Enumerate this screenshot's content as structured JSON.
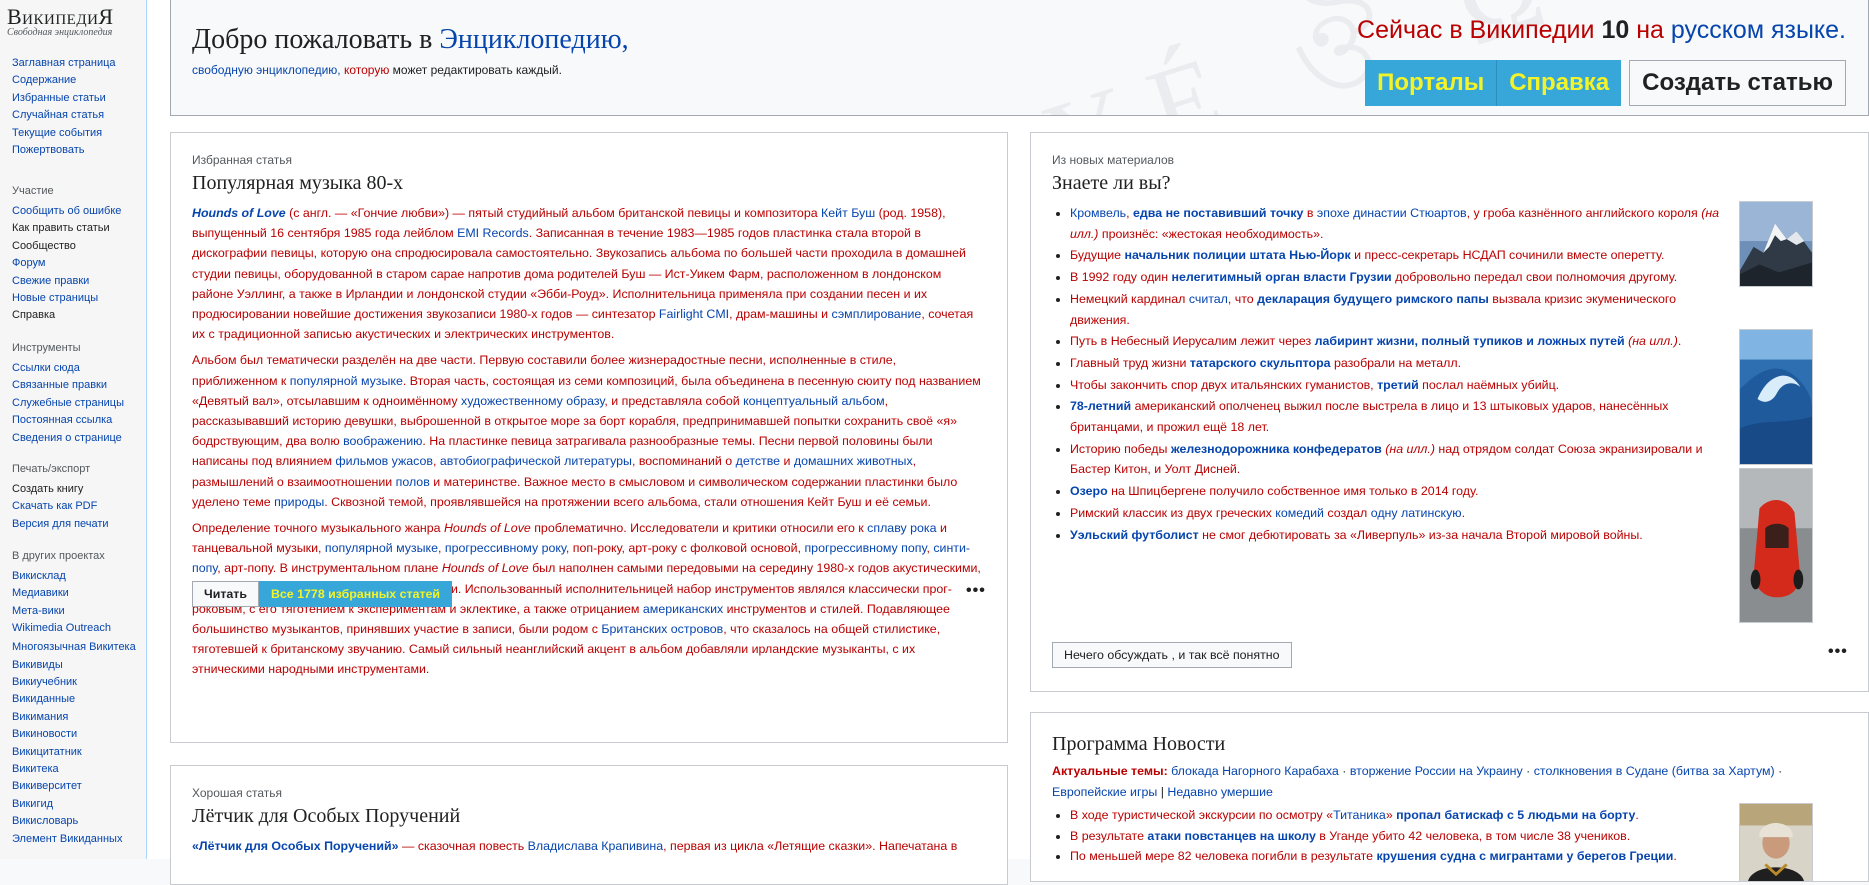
{
  "logo": {
    "title": "ВикипедиЯ",
    "subtitle": "Свободная энциклопедия"
  },
  "sidebar": {
    "main": [
      "Заглавная страница",
      "Содержание",
      "Избранные статьи",
      "Случайная статья",
      "Текущие события",
      "Пожертвовать"
    ],
    "participation": {
      "heading": "Участие",
      "items": [
        "Сообщить об ошибке",
        "Как править статьи",
        "Сообщество",
        "Форум",
        "Свежие правки",
        "Новые страницы",
        "Справка"
      ]
    },
    "tools": {
      "heading": "Инструменты",
      "items": [
        "Ссылки сюда",
        "Связанные правки",
        "Служебные страницы",
        "Постоянная ссылка",
        "Сведения о странице"
      ]
    },
    "print": {
      "heading": "Печать/экспорт",
      "items": [
        "Создать книгу",
        "Скачать как PDF",
        "Версия для печати"
      ]
    },
    "projects": {
      "heading": "В других проектах",
      "items": [
        "Викисклад",
        "Медиавики",
        "Мета-вики",
        "Wikimedia Outreach",
        "Многоязычная Викитека",
        "Викивиды",
        "Викиучебник",
        "Викиданные",
        "Викимания",
        "Викиновости",
        "Викицитатник",
        "Викитека",
        "Викиверситет",
        "Викигид",
        "Викисловарь",
        "Элемент Викиданных"
      ]
    }
  },
  "welcome": {
    "title_prefix": "Добро пожаловать в ",
    "title_link": "Энциклопедию,",
    "sub_1": "свободную энциклопедию, ",
    "sub_2": "которую",
    "sub_3": " может редактировать каждый.",
    "count_1": "Сейчас в Википедии ",
    "count_num": "10",
    "count_2": " на ",
    "count_link": "русском языке.",
    "btn_portals": "Порталы",
    "btn_help": "Справка",
    "btn_create": "Создать статью",
    "background_glyphs": "ΑΥÉ ঔ Ω"
  },
  "featured": {
    "kicker": "Избранная статья",
    "title": "Популярная музыка 80-х",
    "p1": [
      {
        "t": "Hounds of Love",
        "c": "blue b i"
      },
      {
        "t": " (с англ. — «Гончие любви») — пятый студийный альбом британской ",
        "c": ""
      },
      {
        "t": "певицы и композитора",
        "c": ""
      },
      {
        "t": " Кейт Буш",
        "c": "blue"
      },
      {
        "t": " (род. 1958), выпущенный 16 сентября 1985 года лейблом ",
        "c": ""
      },
      {
        "t": "EMI Records",
        "c": "blue"
      },
      {
        "t": ". Записанная в течение 1983—1985 годов пластинка стала второй в дискографии певицы, которую она спродюсировала самостоятельно. Звукозапись альбома по большей части проходила в домашней студии певицы, оборудованной в старом сарае напротив дома родителей Буш — Ист-Уикем Фарм, расположенном в лондонском районе Уэллинг, а также в Ирландии и лондонской студии «Эбби-Роуд». Исполнительница применяла при создании песен и их продюсировании новейшие достижения звукозаписи 1980-х годов — синтезатор ",
        "c": ""
      },
      {
        "t": "Fairlight CMI",
        "c": "blue"
      },
      {
        "t": ", драм-машины и ",
        "c": ""
      },
      {
        "t": "сэмплирование",
        "c": "blue"
      },
      {
        "t": ", сочетая их с традиционной записью акустических и электрических инструментов.",
        "c": ""
      }
    ],
    "p2": [
      {
        "t": "Альбом был тематически разделён на две части. Первую составили более жизнерадостные песни, исполненные в стиле, приближенном к ",
        "c": ""
      },
      {
        "t": "популярной музыке",
        "c": "blue"
      },
      {
        "t": ". Вторая часть, состоящая из семи композиций, была объединена в песенную сюиту под названием «Девятый вал», отсылавшим к одноимённому ",
        "c": ""
      },
      {
        "t": "художественному образу",
        "c": "blue"
      },
      {
        "t": ", и представляла собой ",
        "c": ""
      },
      {
        "t": "концептуальный альбом",
        "c": "blue"
      },
      {
        "t": ", рассказывавший историю девушки, выброшенной в открытое море за борт корабля, предпринимавшей попытки сохранить своё «я» бодрствующим, два волю ",
        "c": ""
      },
      {
        "t": "воображению",
        "c": "blue"
      },
      {
        "t": ". На пластинке певица затрагивала разнообразные темы. Песни первой половины были написаны под влиянием ",
        "c": ""
      },
      {
        "t": "фильмов ужасов",
        "c": "blue"
      },
      {
        "t": ", ",
        "c": ""
      },
      {
        "t": "автобиографической литературы",
        "c": "blue"
      },
      {
        "t": ", воспоминаний о ",
        "c": ""
      },
      {
        "t": "детстве",
        "c": "blue"
      },
      {
        "t": " и ",
        "c": ""
      },
      {
        "t": "домашних животных",
        "c": "blue"
      },
      {
        "t": ", размышлений о взаимоотношении ",
        "c": ""
      },
      {
        "t": "полов",
        "c": "blue"
      },
      {
        "t": " и материнстве. Важное место в смысловом и символическом содержании пластинки было уделено теме ",
        "c": ""
      },
      {
        "t": "природы",
        "c": "blue"
      },
      {
        "t": ". Сквозной темой, проявлявшейся на протяжении всего альбома, стали отношения Кейт Буш и её семьи.",
        "c": ""
      }
    ],
    "p3": [
      {
        "t": "Определение точного музыкального жанра ",
        "c": ""
      },
      {
        "t": "Hounds of Love",
        "c": "i"
      },
      {
        "t": " проблематично. Исследователи и критики относили его к ",
        "c": ""
      },
      {
        "t": "сплаву рока",
        "c": "blue"
      },
      {
        "t": " и танцевальной музыки, ",
        "c": ""
      },
      {
        "t": "популярной музыке",
        "c": "blue"
      },
      {
        "t": ", ",
        "c": ""
      },
      {
        "t": "прогрессивному року",
        "c": "blue"
      },
      {
        "t": ", поп-року, арт-року с фолковой основой, ",
        "c": ""
      },
      {
        "t": "прогрессивному попу",
        "c": "blue"
      },
      {
        "t": ", ",
        "c": ""
      },
      {
        "t": "синти-попу",
        "c": "blue"
      },
      {
        "t": ", арт-попу. В инструментальном плане ",
        "c": ""
      },
      {
        "t": "Hounds of Love",
        "c": "i"
      },
      {
        "t": " был наполнен самыми передовыми на середину 1980-х годов акустическими, электрическими и синтезированными звуками. Использованный исполнительницей набор инструментов являлся классически прог-роковым, с его тяготением к экспериментам и эклектике, а также отрицанием ",
        "c": ""
      },
      {
        "t": "американских",
        "c": "blue"
      },
      {
        "t": " инструментов и стилей. Подавляющее большинство музыкантов, принявших участие в записи, были родом с ",
        "c": ""
      },
      {
        "t": "Британских островов",
        "c": "blue"
      },
      {
        "t": ", что сказалось на общей стилистике, тяготевшей к британскому звучанию. Самый сильный неанглийский акцент в альбом добавляли ирландские музыканты, с их этническими народными инструментами.",
        "c": ""
      }
    ],
    "btn_read": "Читать",
    "btn_all": "Все 1778 избранных статей",
    "more": "•••"
  },
  "dyk": {
    "kicker": "Из новых материалов",
    "title": "Знаете ли вы?",
    "items": [
      [
        {
          "t": "Кромвель",
          "c": "blue"
        },
        {
          "t": ", ",
          "c": ""
        },
        {
          "t": "едва не поставивший точку",
          "c": "blue b"
        },
        {
          "t": " в ",
          "c": ""
        },
        {
          "t": "эпохе династии Стюартов",
          "c": "blue"
        },
        {
          "t": ", у гроба казнённого английского короля ",
          "c": ""
        },
        {
          "t": "(на илл.)",
          "c": "i"
        },
        {
          "t": " произнёс: «жестокая необходимость».",
          "c": ""
        }
      ],
      [
        {
          "t": "Будущие ",
          "c": ""
        },
        {
          "t": "начальник полиции штата Нью-Йорк",
          "c": "blue b"
        },
        {
          "t": " и пресс-секретарь НСДАП сочинили вместе оперетту.",
          "c": ""
        }
      ],
      [
        {
          "t": "В 1992 году",
          "c": ""
        },
        {
          "t": " один ",
          "c": ""
        },
        {
          "t": "нелегитимный орган власти Грузии",
          "c": "blue b"
        },
        {
          "t": " добровольно передал свои полномочия другому.",
          "c": ""
        }
      ],
      [
        {
          "t": "Немецкий кардинал ",
          "c": ""
        },
        {
          "t": "считал",
          "c": "blue"
        },
        {
          "t": ", что ",
          "c": ""
        },
        {
          "t": "декларация будущего римского папы",
          "c": "blue b"
        },
        {
          "t": " вызвала кризис экуменического движения.",
          "c": ""
        }
      ],
      [
        {
          "t": "Путь в Небесный Иерусалим",
          "c": ""
        },
        {
          "t": " лежит через ",
          "c": ""
        },
        {
          "t": "лабиринт жизни, полный тупиков и ложных путей",
          "c": "blue b"
        },
        {
          "t": " ",
          "c": ""
        },
        {
          "t": "(на илл.)",
          "c": "i"
        },
        {
          "t": ".",
          "c": ""
        }
      ],
      [
        {
          "t": "Главный труд жизни ",
          "c": ""
        },
        {
          "t": "татарского скульптора",
          "c": "blue b"
        },
        {
          "t": " разобрали на металл.",
          "c": ""
        }
      ],
      [
        {
          "t": "Чтобы закончить спор двух итальянских гуманистов, ",
          "c": ""
        },
        {
          "t": "третий",
          "c": "blue b"
        },
        {
          "t": " послал наёмных убийц.",
          "c": ""
        }
      ],
      [
        {
          "t": "78-летний",
          "c": "blue b"
        },
        {
          "t": " американский ополченец выжил после выстрела в лицо и 13 штыковых ударов, нанесённых британцами, и прожил ещё 18 лет.",
          "c": ""
        }
      ],
      [
        {
          "t": "Историю победы ",
          "c": ""
        },
        {
          "t": "железнодорожника конфедератов",
          "c": "blue b"
        },
        {
          "t": " ",
          "c": ""
        },
        {
          "t": "(на илл.)",
          "c": "i"
        },
        {
          "t": " над отрядом солдат Союза ",
          "c": ""
        },
        {
          "t": "экранизировали",
          "c": ""
        },
        {
          "t": " и Бастер Китон, и Уолт Дисней.",
          "c": ""
        }
      ],
      [
        {
          "t": "Озеро",
          "c": "blue b"
        },
        {
          "t": " на Шпицбергене получило собственное имя только в 2014 году.",
          "c": ""
        }
      ],
      [
        {
          "t": "Римский классик из двух греческих ",
          "c": ""
        },
        {
          "t": "комедий",
          "c": "blue"
        },
        {
          "t": " создал ",
          "c": ""
        },
        {
          "t": "одну латинскую",
          "c": "blue"
        },
        {
          "t": ".",
          "c": ""
        }
      ],
      [
        {
          "t": "Уэльский футболист",
          "c": "blue b"
        },
        {
          "t": " не смог дебютировать за «Ливерпуль» из-за начала Второй мировой войны.",
          "c": ""
        }
      ]
    ],
    "btn_discuss": "Нечего обсуждать , и так всё понятно",
    "more": "•••",
    "thumbs": [
      "mountain-photo",
      "wave-photo",
      "red-car-photo"
    ]
  },
  "good": {
    "kicker": "Хорошая статья",
    "title": "Лётчик для Особых Поручений",
    "p1": [
      {
        "t": "«Лётчик для Особых Поручений»",
        "c": "blue b"
      },
      {
        "t": " — сказочная повесть ",
        "c": ""
      },
      {
        "t": "Владислава Крапивина",
        "c": "blue"
      },
      {
        "t": ", первая из цикла «Летящие сказки». Напечатана в",
        "c": ""
      }
    ]
  },
  "news": {
    "title": "Программа Новости",
    "topics_label": "Актуальные темы:",
    "topics": [
      {
        "t": " блокада Нагорного Карабаха",
        "c": "blue"
      },
      {
        "t": " · ",
        "c": "dark"
      },
      {
        "t": "вторжение России на Украину",
        "c": "blue"
      },
      {
        "t": " · ",
        "c": "dark"
      },
      {
        "t": "столкновения в Судане (битва за Хартум)",
        "c": "blue"
      },
      {
        "t": " · ",
        "c": "dark"
      },
      {
        "t": "Европейские игры",
        "c": "blue"
      },
      {
        "t": " | ",
        "c": "dark"
      },
      {
        "t": "Недавно умершие",
        "c": "blue"
      }
    ],
    "items": [
      [
        {
          "t": "В ходе туристической экскурсии по осмотру «",
          "c": ""
        },
        {
          "t": "Титаника",
          "c": "blue"
        },
        {
          "t": "» ",
          "c": ""
        },
        {
          "t": "пропал батискаф с 5 людьми на борту",
          "c": "blue b"
        },
        {
          "t": ".",
          "c": ""
        }
      ],
      [
        {
          "t": "В результате ",
          "c": ""
        },
        {
          "t": "атаки повстанцев на школу",
          "c": "blue b"
        },
        {
          "t": " в Уганде убито 42 человека, в том числе 38 учеников.",
          "c": ""
        }
      ],
      [
        {
          "t": "По меньшей мере 82 человека погибли в результате ",
          "c": ""
        },
        {
          "t": "крушения судна с мигрантами у берегов Греции",
          "c": "blue b"
        },
        {
          "t": ".",
          "c": ""
        }
      ]
    ],
    "thumb": "hockey-player-photo"
  },
  "colors": {
    "link": "#0645ad",
    "red_link": "#ba0000",
    "accent_button": "#36a7d8",
    "accent_button_text": "#f3f32a"
  }
}
